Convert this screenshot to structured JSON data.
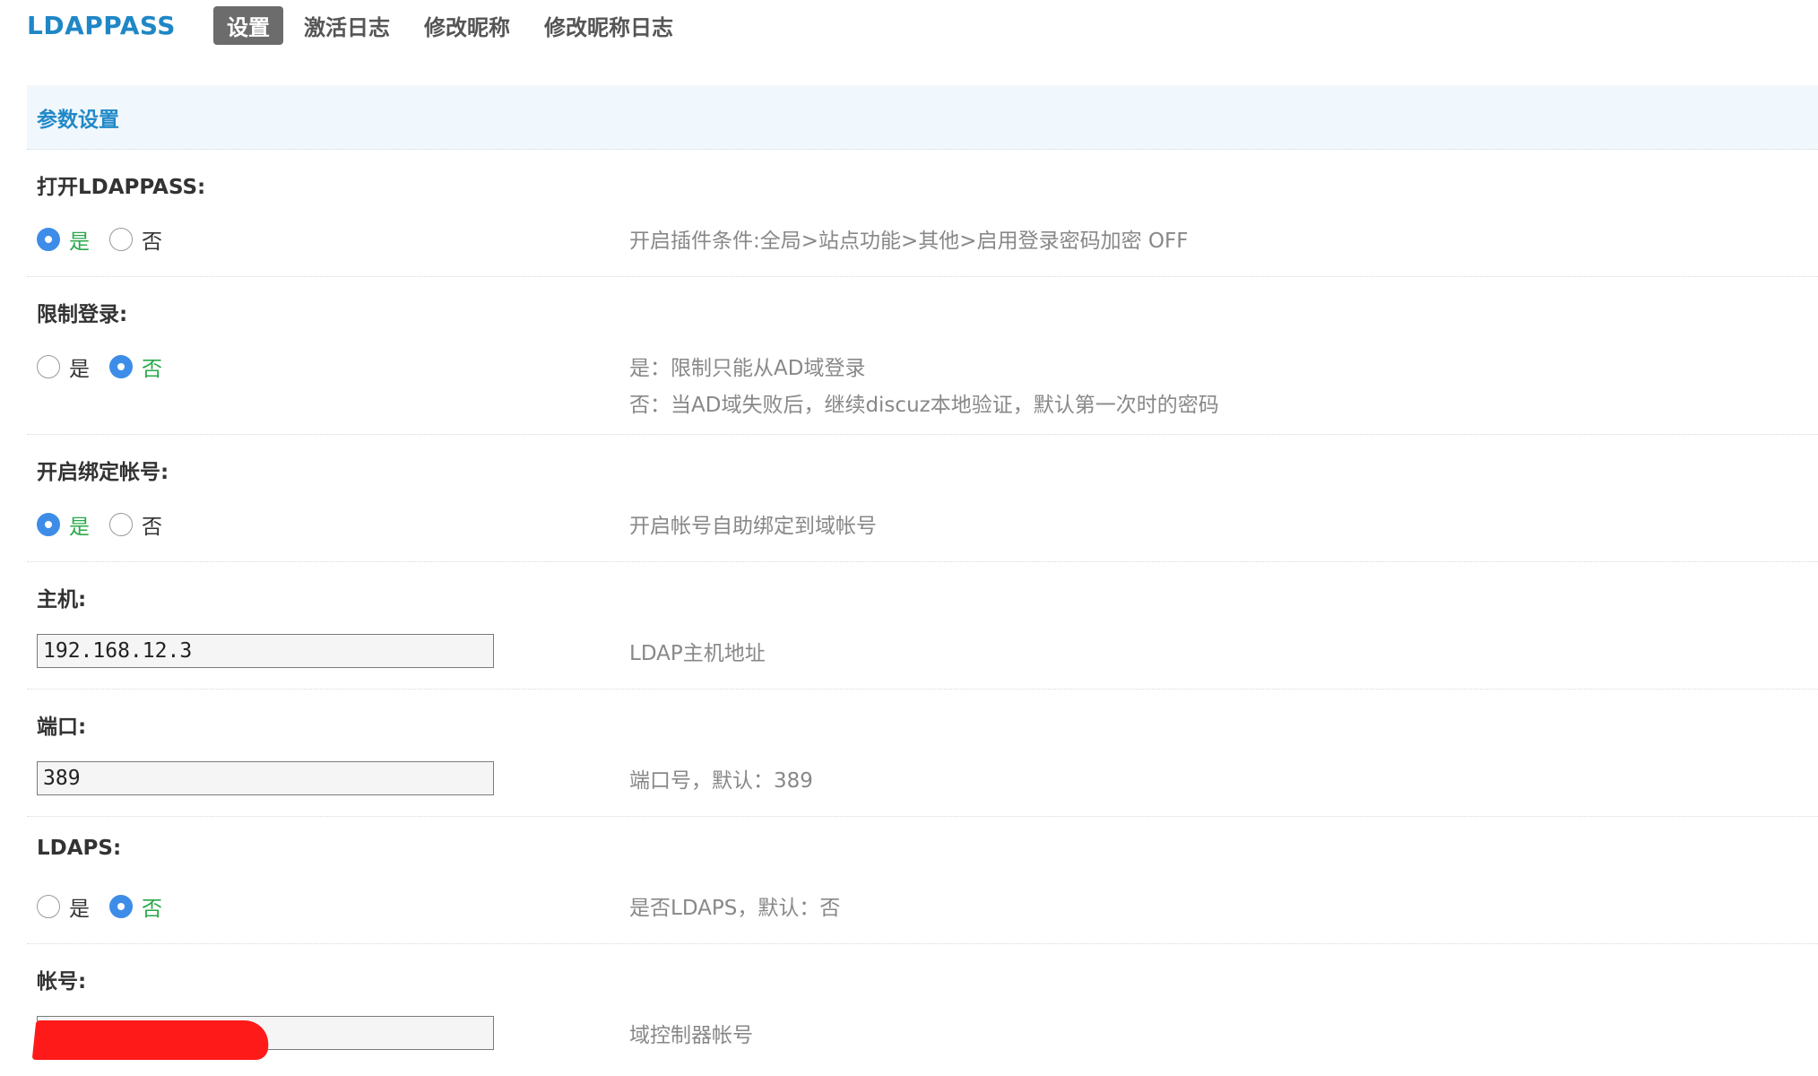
{
  "nav": {
    "brand": "LDAPPASS",
    "items": [
      {
        "label": "设置",
        "active": true
      },
      {
        "label": "激活日志",
        "active": false
      },
      {
        "label": "修改昵称",
        "active": false
      },
      {
        "label": "修改昵称日志",
        "active": false
      }
    ]
  },
  "section": {
    "title": "参数设置"
  },
  "settings": {
    "enable": {
      "label": "打开LDAPPASS:",
      "options": [
        "是",
        "否"
      ],
      "selected": "是",
      "hint": "开启插件条件:全局>站点功能>其他>启用登录密码加密 OFF"
    },
    "restrict": {
      "label": "限制登录:",
      "options": [
        "是",
        "否"
      ],
      "selected": "否",
      "hints": [
        "是：限制只能从AD域登录",
        "否：当AD域失败后，继续discuz本地验证，默认第一次时的密码"
      ]
    },
    "bind": {
      "label": "开启绑定帐号:",
      "options": [
        "是",
        "否"
      ],
      "selected": "是",
      "hint": "开启帐号自助绑定到域帐号"
    },
    "host": {
      "label": "主机:",
      "value": "192.168.12.3",
      "hint": "LDAP主机地址"
    },
    "port": {
      "label": "端口:",
      "value": "389",
      "hint": "端口号，默认：389"
    },
    "ldaps": {
      "label": "LDAPS:",
      "options": [
        "是",
        "否"
      ],
      "selected": "否",
      "hint": "是否LDAPS，默认：否"
    },
    "account": {
      "label": "帐号:",
      "value": "",
      "redacted": true,
      "hint": "域控制器帐号"
    }
  },
  "colors": {
    "brand": "#1f87c6",
    "section_bg": "#f1f8fd",
    "radio_checked": "#3d8de8",
    "selected_text": "#2aa84a",
    "hint_text": "#888888",
    "redaction": "#ff1a1a"
  }
}
